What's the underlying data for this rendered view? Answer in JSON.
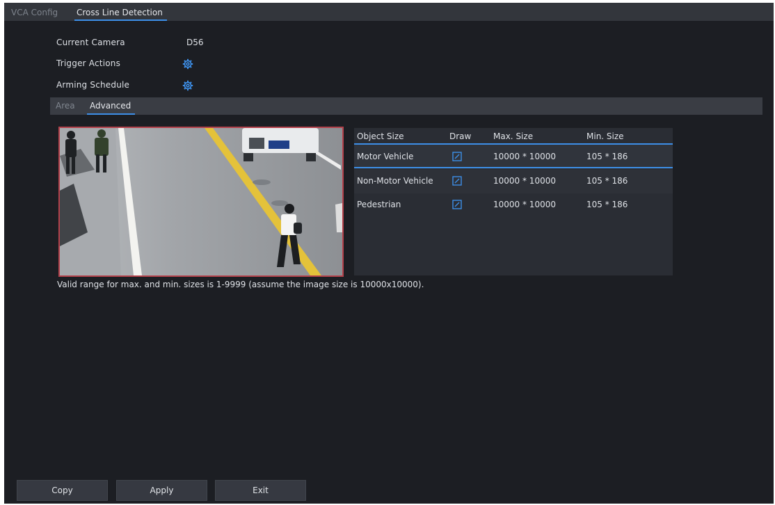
{
  "tabs": [
    {
      "label": "VCA Config"
    },
    {
      "label": "Cross Line Detection"
    }
  ],
  "form": {
    "current_camera_label": "Current Camera",
    "current_camera_value": "D56",
    "trigger_actions_label": "Trigger Actions",
    "arming_schedule_label": "Arming Schedule"
  },
  "sub_tabs": [
    {
      "label": "Area"
    },
    {
      "label": "Advanced"
    }
  ],
  "table": {
    "headers": {
      "object_size": "Object Size",
      "draw": "Draw",
      "max_size": "Max. Size",
      "min_size": "Min. Size"
    },
    "rows": [
      {
        "object": "Motor Vehicle",
        "max": "10000 * 10000",
        "min": "105 * 186"
      },
      {
        "object": "Non-Motor Vehicle",
        "max": "10000 * 10000",
        "min": "105 * 186"
      },
      {
        "object": "Pedestrian",
        "max": "10000 * 10000",
        "min": "105 * 186"
      }
    ]
  },
  "note": "Valid range for max. and min. sizes is 1-9999 (assume the image size is 10000x10000).",
  "buttons": {
    "copy": "Copy",
    "apply": "Apply",
    "exit": "Exit"
  },
  "colors": {
    "accent": "#3d8fe8",
    "background": "#1c1e23",
    "border_highlight": "#b3404a"
  },
  "icons": {
    "gear": "gear-icon",
    "edit": "edit-icon"
  }
}
